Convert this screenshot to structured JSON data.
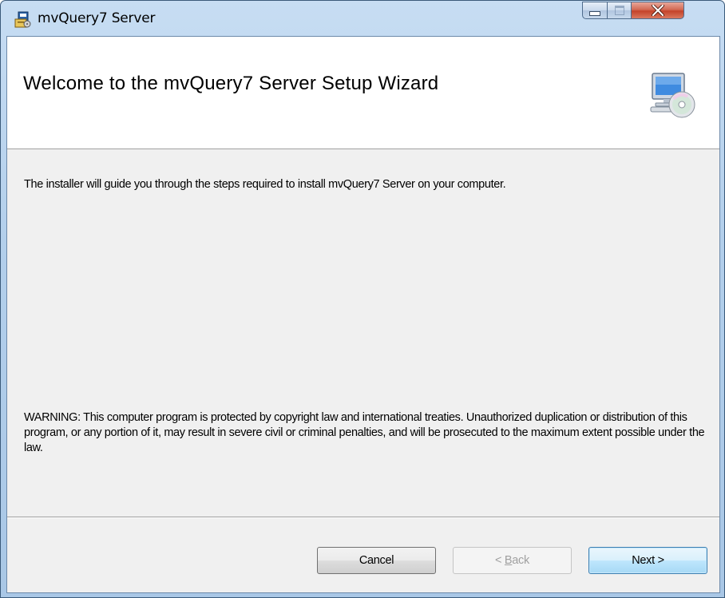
{
  "window": {
    "title": "mvQuery7 Server",
    "app_icon": "installer-icon"
  },
  "caption_buttons": {
    "minimize_icon": "minimize-icon",
    "maximize_icon": "maximize-icon",
    "close_icon": "close-icon",
    "close_label": "X"
  },
  "banner": {
    "title": "Welcome to the mvQuery7 Server Setup Wizard",
    "icon": "computer-cd-icon"
  },
  "body": {
    "intro": "The installer will guide you through the steps required to install mvQuery7 Server on your computer.",
    "warning": "WARNING: This computer program is protected by copyright law and international treaties. Unauthorized duplication or distribution of this program, or any portion of it, may result in severe civil or criminal penalties, and will be prosecuted to the maximum extent possible under the law."
  },
  "buttons": {
    "cancel": "Cancel",
    "back_prefix": "< ",
    "back_accel": "B",
    "back_rest": "ack",
    "next": "Next >"
  },
  "colors": {
    "titlebar": "#b3cfeb",
    "close_button": "#c4432a",
    "client_bg": "#f0f0f0",
    "default_button_border": "#3c7fb1"
  }
}
